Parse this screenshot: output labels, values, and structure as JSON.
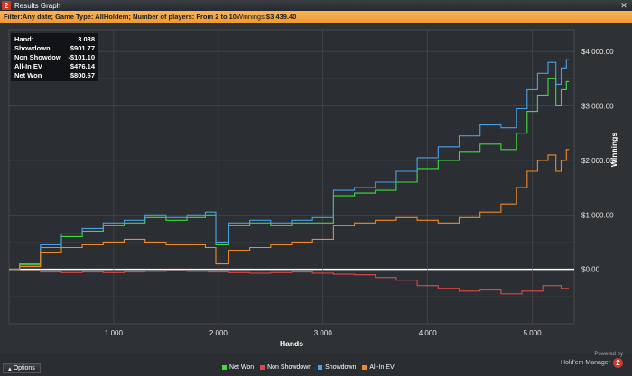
{
  "window": {
    "app_icon_label": "2",
    "title": "Results Graph",
    "close_glyph": "✕"
  },
  "filter": {
    "prefix": "Filter:",
    "text": " Any date; Game Type: AllHoldem; Number of players: From 2 to 10",
    "winnings_label": " Winnings: ",
    "winnings_value": "$3 439.40"
  },
  "stats": [
    {
      "label": "Hand:",
      "value": "3 038"
    },
    {
      "label": "Showdown",
      "value": "$901.77"
    },
    {
      "label": "Non Showdow",
      "value": "-$101.10"
    },
    {
      "label": "All-In EV",
      "value": "$476.14"
    },
    {
      "label": "Net Won",
      "value": "$800.67"
    }
  ],
  "options_label": "Options",
  "brand": {
    "powered_by": "Powered by",
    "name": "Hold'em Manager",
    "logo": "2"
  },
  "colors": {
    "net_won": "#3ddc3d",
    "non_showdown": "#e04848",
    "showdown": "#4a9fe8",
    "all_in_ev": "#f08a28",
    "zero_line": "#ffffff",
    "grid": "#4a4f54"
  },
  "chart_data": {
    "type": "line",
    "xlabel": "Hands",
    "ylabel": "Winnings",
    "xlim": [
      0,
      5400
    ],
    "ylim": [
      -1000,
      4400
    ],
    "x_ticks": [
      1000,
      2000,
      3000,
      4000,
      5000
    ],
    "x_tick_labels": [
      "1 000",
      "2 000",
      "3 000",
      "4 000",
      "5 000"
    ],
    "y_ticks": [
      0,
      1000,
      2000,
      3000,
      4000
    ],
    "y_tick_labels": [
      "$0.00",
      "$1 000.00",
      "$2 000.00",
      "$3 000.00",
      "$4 000.00"
    ],
    "grid": true,
    "legend_position": "bottom",
    "series": [
      {
        "name": "Net Won",
        "color_key": "net_won",
        "x": [
          0,
          200,
          400,
          600,
          800,
          1000,
          1200,
          1400,
          1600,
          1800,
          1950,
          2000,
          2200,
          2400,
          2600,
          2800,
          3000,
          3200,
          3400,
          3600,
          3800,
          4000,
          4200,
          4400,
          4600,
          4800,
          4900,
          5000,
          5100,
          5200,
          5250,
          5300,
          5350
        ],
        "y": [
          0,
          80,
          400,
          600,
          700,
          800,
          850,
          950,
          900,
          950,
          1000,
          450,
          800,
          850,
          800,
          850,
          850,
          1350,
          1400,
          1450,
          1600,
          1850,
          2000,
          2150,
          2300,
          2200,
          2500,
          2900,
          3200,
          3500,
          3000,
          3300,
          3450
        ]
      },
      {
        "name": "Non Showdown",
        "color_key": "non_showdown",
        "x": [
          0,
          200,
          400,
          600,
          800,
          1000,
          1200,
          1400,
          1600,
          1800,
          2000,
          2200,
          2400,
          2600,
          2800,
          3000,
          3200,
          3400,
          3600,
          3800,
          4000,
          4200,
          4400,
          4600,
          4800,
          5000,
          5200,
          5350
        ],
        "y": [
          0,
          -30,
          -50,
          -60,
          -50,
          -60,
          -50,
          -40,
          -30,
          -40,
          -50,
          -60,
          -70,
          -60,
          -50,
          -70,
          -90,
          -100,
          -150,
          -200,
          -300,
          -350,
          -400,
          -380,
          -450,
          -400,
          -300,
          -350
        ]
      },
      {
        "name": "Showdown",
        "color_key": "showdown",
        "x": [
          0,
          200,
          400,
          600,
          800,
          1000,
          1200,
          1400,
          1600,
          1800,
          1950,
          2000,
          2200,
          2400,
          2600,
          2800,
          3000,
          3200,
          3400,
          3600,
          3800,
          4000,
          4200,
          4400,
          4600,
          4800,
          4900,
          5000,
          5100,
          5200,
          5250,
          5300,
          5350
        ],
        "y": [
          0,
          100,
          450,
          650,
          750,
          850,
          900,
          1000,
          950,
          1000,
          1050,
          500,
          850,
          900,
          850,
          900,
          950,
          1450,
          1500,
          1600,
          1800,
          2050,
          2250,
          2450,
          2650,
          2600,
          2950,
          3300,
          3600,
          3800,
          3400,
          3700,
          3850
        ]
      },
      {
        "name": "All-In EV",
        "color_key": "all_in_ev",
        "x": [
          0,
          200,
          400,
          600,
          800,
          1000,
          1200,
          1400,
          1600,
          1800,
          1950,
          2000,
          2200,
          2400,
          2600,
          2800,
          3000,
          3200,
          3400,
          3600,
          3800,
          4000,
          4200,
          4400,
          4600,
          4800,
          4900,
          5000,
          5100,
          5200,
          5250,
          5300,
          5350
        ],
        "y": [
          0,
          50,
          300,
          400,
          450,
          500,
          550,
          500,
          450,
          450,
          400,
          100,
          350,
          400,
          450,
          500,
          550,
          800,
          850,
          900,
          950,
          900,
          850,
          950,
          1050,
          1200,
          1500,
          1800,
          2000,
          2100,
          1800,
          2000,
          2200
        ]
      }
    ]
  }
}
